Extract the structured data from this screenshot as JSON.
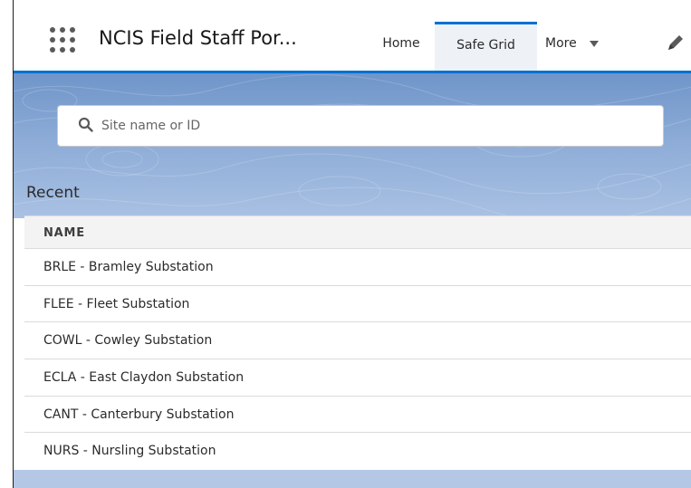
{
  "app": {
    "name": "NCIS Field Staff Por...",
    "launcher_icon": "app-launcher-grid-icon"
  },
  "nav": {
    "tabs": [
      {
        "label": "Home",
        "active": false
      },
      {
        "label": "Safe Grid",
        "active": true
      },
      {
        "label": "More",
        "active": false,
        "has_dropdown": true
      }
    ],
    "edit_icon": "pencil-icon"
  },
  "search": {
    "placeholder": "Site name or ID",
    "value": "",
    "icon": "search-icon"
  },
  "recent": {
    "title": "Recent",
    "column_header": "NAME",
    "items": [
      "BRLE - Bramley Substation",
      "FLEE - Fleet Substation",
      "COWL - Cowley Substation",
      "ECLA - East Claydon Substation",
      "CANT - Canterbury Substation",
      "NURS - Nursling Substation"
    ]
  },
  "colors": {
    "accent": "#0070d2",
    "banner_top": "#6f95c9",
    "banner_bottom": "#a9c1e3"
  }
}
